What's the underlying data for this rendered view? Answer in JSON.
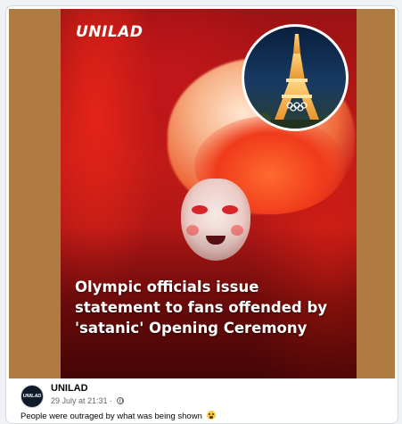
{
  "media": {
    "logo_text": "UNILAD",
    "headline_lines": [
      "Olympic officials issue",
      "statement to fans offended by",
      "'satanic' Opening Ceremony"
    ]
  },
  "post": {
    "avatar_text": "UNILAD",
    "page_name": "UNILAD",
    "timestamp": "29 July at 21:31 ·",
    "caption": "People were outraged by what was being shown",
    "icons": [
      "globe-icon",
      "scream-emoji-icon"
    ]
  },
  "colors": {
    "side_background": "#b07a43",
    "video_red": "#c11b17",
    "text_primary": "#050505",
    "text_secondary": "#65676b"
  }
}
